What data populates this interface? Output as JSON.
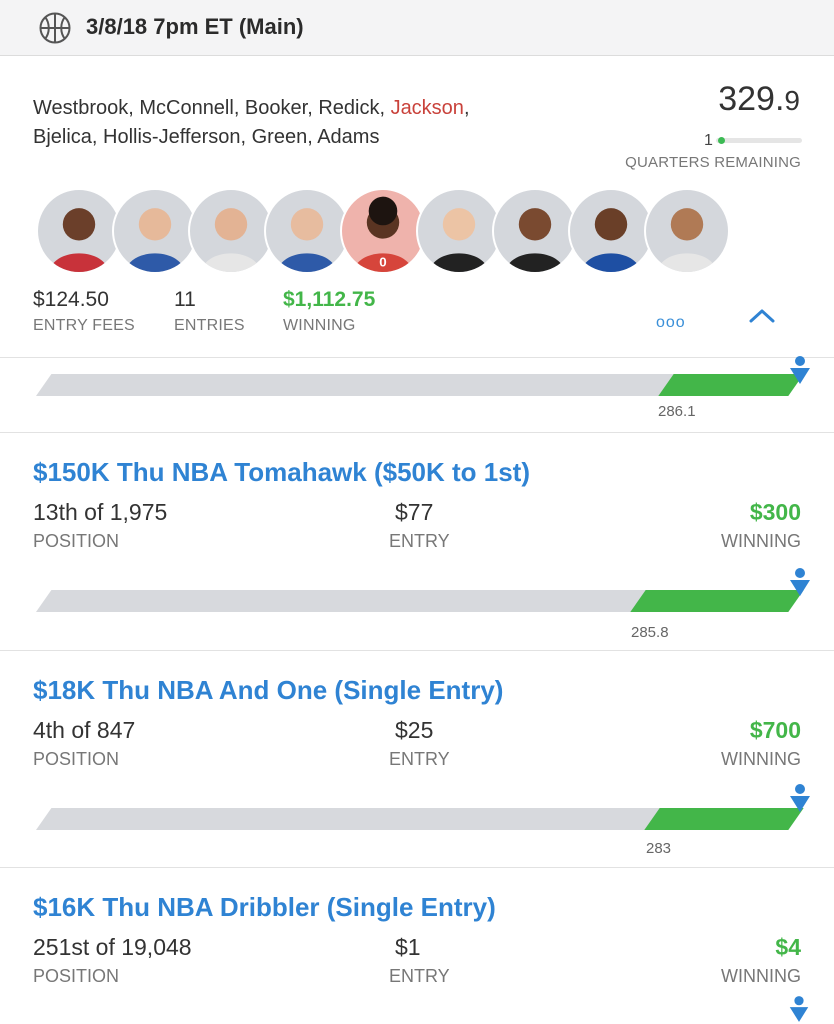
{
  "header": {
    "title": "3/8/18 7pm ET (Main)",
    "icon": "basketball-icon"
  },
  "lineup": {
    "players_line1_a": "Westbrook, McConnell, Booker, Redick, ",
    "players_line1_b": "Jackson",
    "players_line1_c": ",",
    "players_line2": "Bjelica, Hollis-Jefferson, Green, Adams",
    "score_main": "329.",
    "score_dec": "9",
    "quarters_remaining_value": "1",
    "quarters_remaining_label": "QUARTERS REMAINING",
    "avatar_badge": "0",
    "entry_fees": "$124.50",
    "entry_fees_label": "ENTRY FEES",
    "entries": "11",
    "entries_label": "ENTRIES",
    "winning": "$1,112.75",
    "winning_label": "WINNING",
    "more_icon": "ooo"
  },
  "progress_bars": [
    {
      "value": "286.1"
    },
    {
      "value": "285.8"
    },
    {
      "value": "283"
    }
  ],
  "contests": [
    {
      "name": "$150K Thu NBA Tomahawk ($50K to 1st)",
      "position": "13th of 1,975",
      "position_label": "POSITION",
      "entry": "$77",
      "entry_label": "ENTRY",
      "winning": "$300",
      "winning_label": "WINNING"
    },
    {
      "name": "$18K Thu NBA And One (Single Entry)",
      "position": "4th of 847",
      "position_label": "POSITION",
      "entry": "$25",
      "entry_label": "ENTRY",
      "winning": "$700",
      "winning_label": "WINNING"
    },
    {
      "name": "$16K Thu NBA Dribbler (Single Entry)",
      "position": "251st of 19,048",
      "position_label": "POSITION",
      "entry": "$1",
      "entry_label": "ENTRY",
      "winning": "$4",
      "winning_label": "WINNING"
    }
  ],
  "colors": {
    "accent_blue": "#2f83d3",
    "win_green": "#43b649",
    "highlight_red": "#c9423b"
  }
}
